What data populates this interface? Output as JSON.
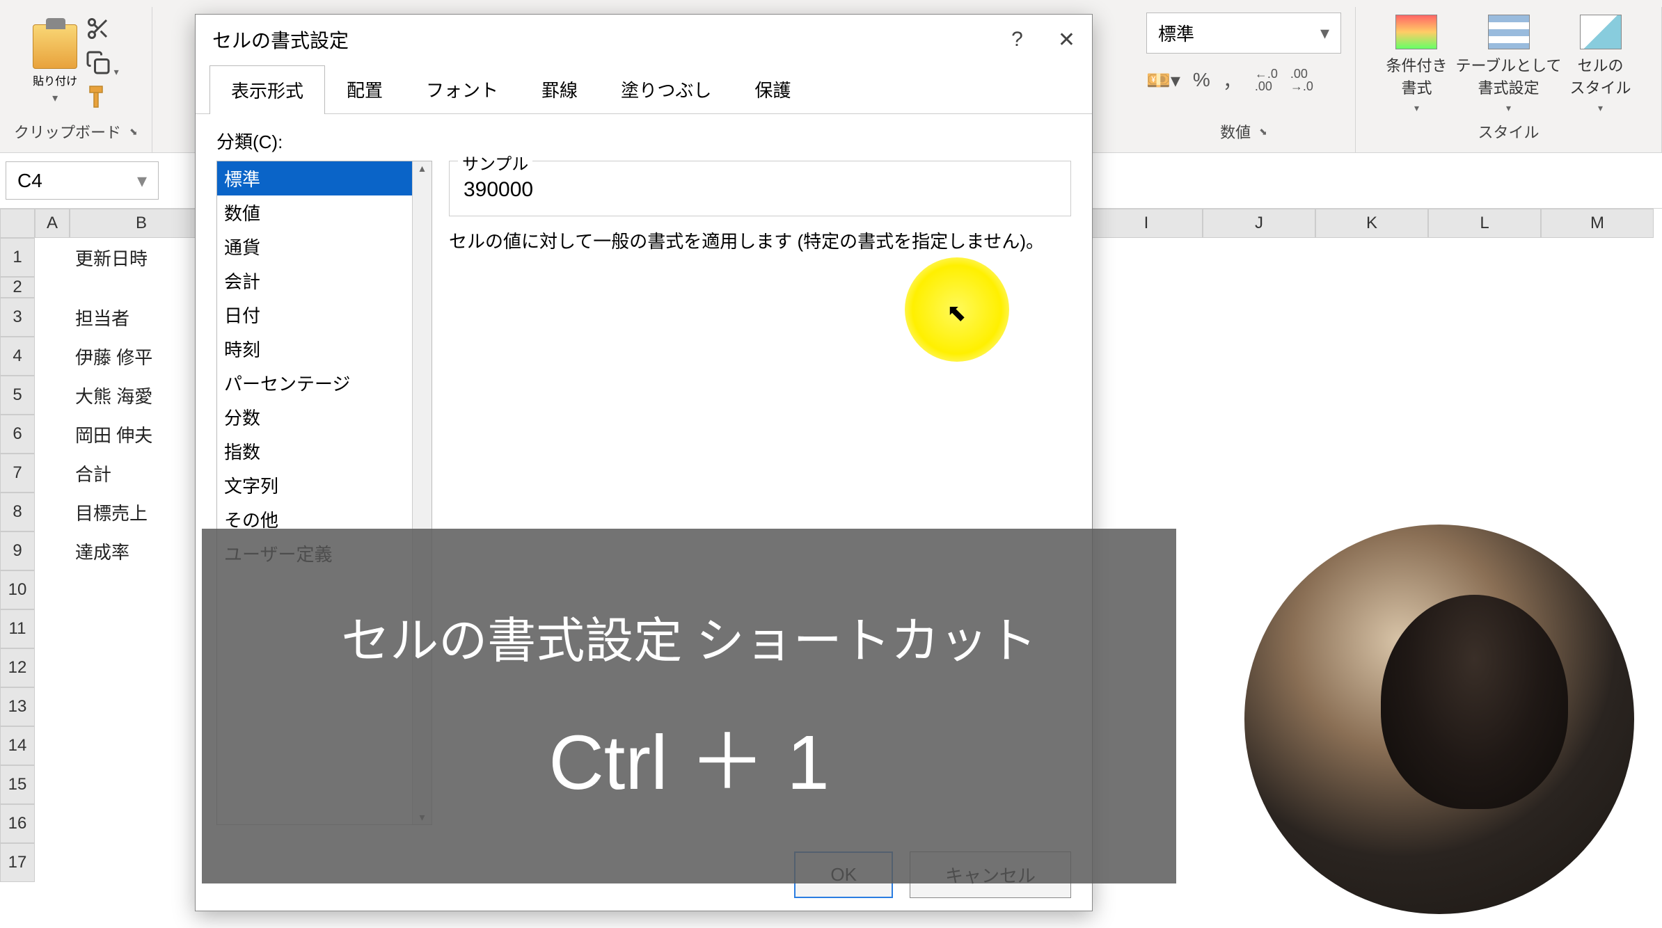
{
  "ribbon": {
    "clipboard": {
      "paste": "貼り付け",
      "label": "クリップボード"
    },
    "number": {
      "format_selected": "標準",
      "label": "数値"
    },
    "styles": {
      "conditional": "条件付き\n書式",
      "table": "テーブルとして\n書式設定",
      "cell": "セルの\nスタイル",
      "label": "スタイル"
    }
  },
  "namebox": "C4",
  "columns": [
    "A",
    "B",
    "I",
    "J",
    "K",
    "L",
    "M"
  ],
  "rows": [
    "1",
    "2",
    "3",
    "4",
    "5",
    "6",
    "7",
    "8",
    "9",
    "10",
    "11",
    "12",
    "13",
    "14",
    "15",
    "16",
    "17"
  ],
  "row_labels": {
    "r1": "更新日時",
    "r3": "担当者",
    "r4": "伊藤 修平",
    "r5": "大熊 海愛",
    "r6": "岡田 伸夫",
    "r7": "合計",
    "r8": "目標売上",
    "r9": "達成率"
  },
  "dialog": {
    "title": "セルの書式設定",
    "help": "?",
    "close": "✕",
    "tabs": [
      "表示形式",
      "配置",
      "フォント",
      "罫線",
      "塗りつぶし",
      "保護"
    ],
    "active_tab": 0,
    "category_label": "分類(C):",
    "categories": [
      "標準",
      "数値",
      "通貨",
      "会計",
      "日付",
      "時刻",
      "パーセンテージ",
      "分数",
      "指数",
      "文字列",
      "その他",
      "ユーザー定義"
    ],
    "selected_category": 0,
    "sample_label": "サンプル",
    "sample_value": "390000",
    "description": "セルの値に対して一般の書式を適用します (特定の書式を指定しません)。",
    "ok": "OK",
    "cancel": "キャンセル"
  },
  "caption": {
    "line1": "セルの書式設定 ショートカット",
    "line2": "Ctrl ＋ 1"
  },
  "number_tools": {
    "percent": "%",
    "comma": "，",
    "inc": ".0\n.00",
    "dec": ".00\n.0"
  }
}
